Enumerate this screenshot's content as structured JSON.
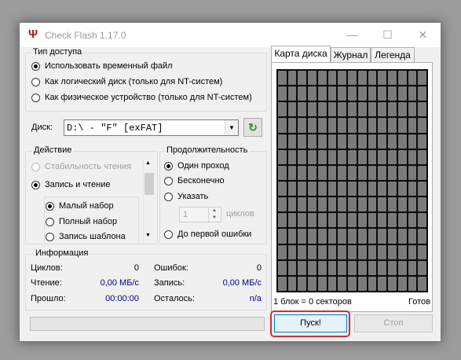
{
  "window": {
    "title": "Check Flash 1.17.0",
    "app_icon": "usb-trident-icon",
    "controls": [
      "minimize-icon",
      "maximize-icon",
      "close-icon"
    ]
  },
  "access_type": {
    "legend": "Тип доступа",
    "options": [
      "Использовать временный файл",
      "Как логический диск (только для NT-систем)",
      "Как физическое устройство (только для NT-систем)"
    ],
    "selected": 0
  },
  "disk": {
    "label": "Диск:",
    "value": "D:\\ - \"F\" [exFAT]",
    "refresh_icon": "refresh-icon"
  },
  "action": {
    "legend": "Действие",
    "options": [
      "Стабильность чтения",
      "Запись и чтение"
    ],
    "selected": 1,
    "sub_options": [
      "Малый набор",
      "Полный набор",
      "Запись шаблона"
    ],
    "sub_selected": 0
  },
  "duration": {
    "legend": "Продолжительность",
    "options": [
      "Один проход",
      "Бесконечно",
      "Указать"
    ],
    "selected": 0,
    "cycles_value": "1",
    "cycles_label": "циклов",
    "until_error": "До первой ошибки"
  },
  "info": {
    "legend": "Информация",
    "cycles_label": "Циклов:",
    "cycles_value": "0",
    "errors_label": "Ошибок:",
    "errors_value": "0",
    "read_label": "Чтение:",
    "read_value": "0,00 МБ/с",
    "write_label": "Запись:",
    "write_value": "0,00 МБ/с",
    "elapsed_label": "Прошло:",
    "elapsed_value": "00:00:00",
    "remaining_label": "Осталось:",
    "remaining_value": "n/a"
  },
  "tabs": [
    "Карта диска",
    "Журнал",
    "Легенда"
  ],
  "active_tab": 0,
  "map": {
    "block_info": "1 блок = 0 секторов",
    "status": "Готов"
  },
  "buttons": {
    "start": "Пуск!",
    "stop": "Стоп"
  },
  "colors": {
    "highlight": "#d32f2f",
    "cell": "#7b7b7b",
    "map_bg": "#0b0b0b",
    "value_blue": "#00008b"
  }
}
